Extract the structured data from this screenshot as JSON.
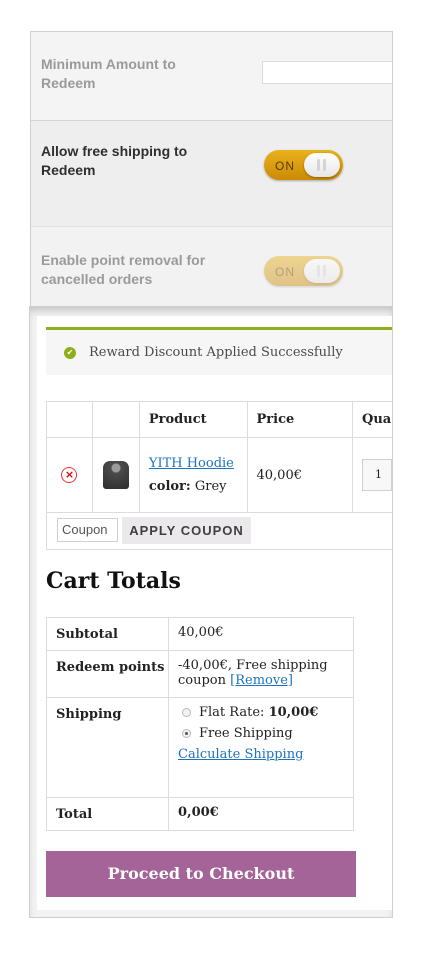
{
  "settings": {
    "min_amount_label": "Minimum Amount to Redeem",
    "min_amount_value": "",
    "free_shipping_label": "Allow free shipping to Redeem",
    "free_shipping_toggle": "ON",
    "point_removal_label": "Enable point removal for cancelled orders",
    "point_removal_toggle": "ON"
  },
  "notice": {
    "icon": "check-icon",
    "text": "Reward Discount Applied Successfully",
    "accent_color": "#8fae1b"
  },
  "cart": {
    "headers": [
      "",
      "",
      "Product",
      "Price",
      "Qua"
    ],
    "rows": [
      {
        "remove_icon": "×",
        "product_name": "YITH Hoodie",
        "attr_label": "color:",
        "attr_value": "Grey",
        "price": "40,00€",
        "qty": "1"
      }
    ],
    "coupon_placeholder": "Coupon",
    "apply_coupon_label": "APPLY COUPON"
  },
  "totals": {
    "title": "Cart Totals",
    "subtotal_label": "Subtotal",
    "subtotal_value": "40,00€",
    "redeem_label": "Redeem points",
    "redeem_value": "-40,00€, Free shipping coupon",
    "redeem_remove": "[Remove]",
    "shipping_label": "Shipping",
    "flat_rate_label": "Flat Rate:",
    "flat_rate_value": "10,00€",
    "free_shipping_label": "Free Shipping",
    "calc_shipping": "Calculate Shipping",
    "total_label": "Total",
    "total_value": "0,00€"
  },
  "checkout": {
    "label": "Proceed to Checkout",
    "color": "#a46497"
  }
}
